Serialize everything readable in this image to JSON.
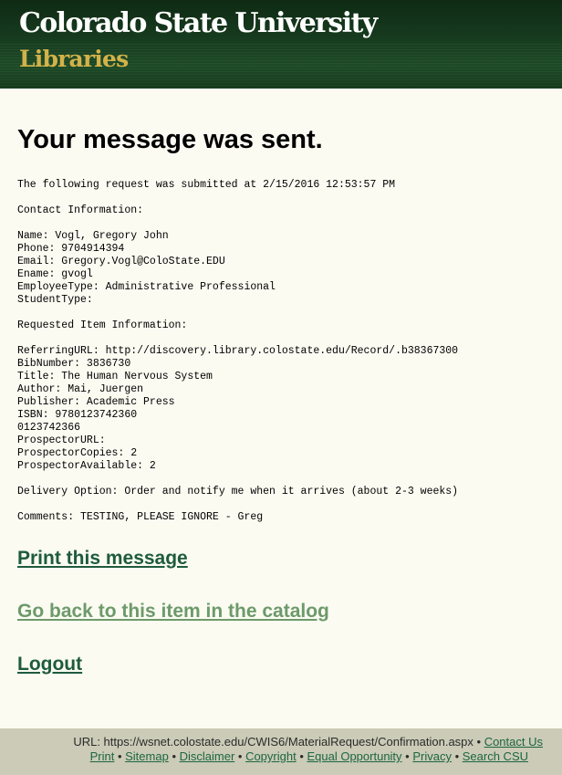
{
  "header": {
    "logo_line1": "Colorado State University",
    "logo_line2": "Libraries"
  },
  "main": {
    "title": "Your message was sent.",
    "message_lines": [
      "The following request was submitted at 2/15/2016 12:53:57 PM",
      "",
      "Contact Information:",
      "",
      "Name: Vogl, Gregory John",
      "Phone: 9704914394",
      "Email: Gregory.Vogl@ColoState.EDU",
      "Ename: gvogl",
      "EmployeeType: Administrative Professional",
      "StudentType:",
      "",
      "Requested Item Information:",
      "",
      "ReferringURL: http://discovery.library.colostate.edu/Record/.b38367300",
      "BibNumber: 3836730",
      "Title: The Human Nervous System",
      "Author: Mai, Juergen",
      "Publisher: Academic Press",
      "ISBN: 9780123742360",
      "0123742366",
      "ProspectorURL:",
      "ProspectorCopies: 2",
      "ProspectorAvailable: 2",
      "",
      "Delivery Option: Order and notify me when it arrives (about 2-3 weeks)",
      "",
      "Comments: TESTING, PLEASE IGNORE - Greg"
    ]
  },
  "links": {
    "print": "Print this message",
    "back": "Go back to this item in the catalog",
    "logout": "Logout"
  },
  "footer": {
    "url_text": "URL: https://wsnet.colostate.edu/CWIS6/MaterialRequest/Confirmation.aspx",
    "separator": " • ",
    "contact_us": "Contact Us",
    "print": "Print",
    "sitemap": "Sitemap",
    "disclaimer": "Disclaimer",
    "copyright": "Copyright",
    "equal_opportunity": "Equal Opportunity",
    "privacy": "Privacy",
    "search_csu": "Search CSU"
  },
  "colors": {
    "header_green": "#17381e",
    "logo_gold": "#d2b24a",
    "link_green": "#1e5b3c",
    "visited_link_green": "#6d9a6a",
    "footer_bg": "#cbcbb7",
    "page_bg": "#fbfbf2"
  }
}
